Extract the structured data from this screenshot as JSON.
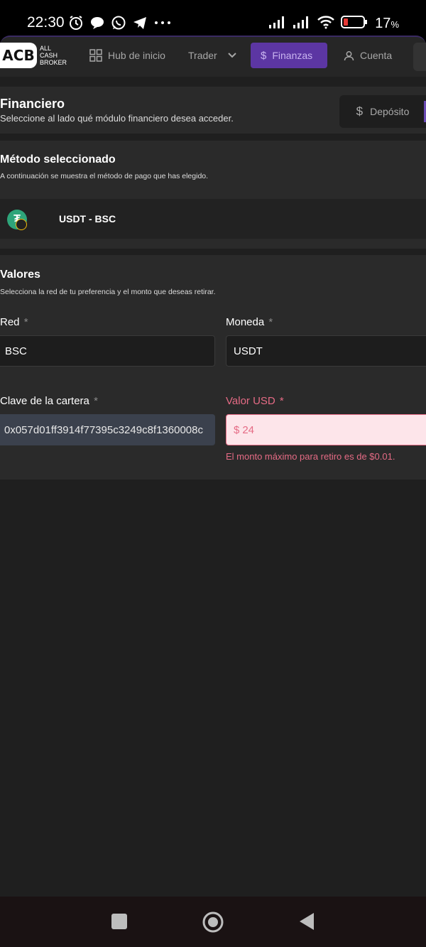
{
  "status_bar": {
    "time": "22:30",
    "battery": "17",
    "battery_unit": "%",
    "icons_left": [
      "alarm-icon",
      "chat-bubble-icon",
      "whatsapp-icon",
      "telegram-icon",
      "more-dots-icon"
    ],
    "icons_right": [
      "signal-icon",
      "signal-icon",
      "wifi-icon",
      "battery-icon"
    ]
  },
  "app": {
    "logo": "ACB",
    "logo_lines": [
      "ALL",
      "CASH",
      "BROKER"
    ],
    "nav": {
      "home": "Hub de inicio",
      "trader": "Trader",
      "finance": "Finanzas",
      "account": "Cuenta"
    },
    "accent_color": "#5c36a3"
  },
  "finance_header": {
    "title": "Financiero",
    "subtitle": "Seleccione al lado qué módulo financiero desea acceder.",
    "deposit_label": "Depósito"
  },
  "method": {
    "title": "Método seleccionado",
    "subtitle": "A continuación se muestra el método de pago que has elegido.",
    "name": "USDT - BSC"
  },
  "values": {
    "title": "Valores",
    "subtitle": "Selecciona la red de tu preferencia y el monto que deseas retirar.",
    "required_mark": "*",
    "network_label": "Red",
    "network_value": "BSC",
    "currency_label": "Moneda",
    "currency_value": "USDT",
    "wallet_label": "Clave de la cartera",
    "wallet_value": "0x057d01ff3914f77395c3249c8f1360008c",
    "amount_label": "Valor USD",
    "amount_prefix": "$",
    "amount_value": "24",
    "amount_error": "El monto máximo para retiro es de $0.01.",
    "error_color": "#e56b85"
  }
}
